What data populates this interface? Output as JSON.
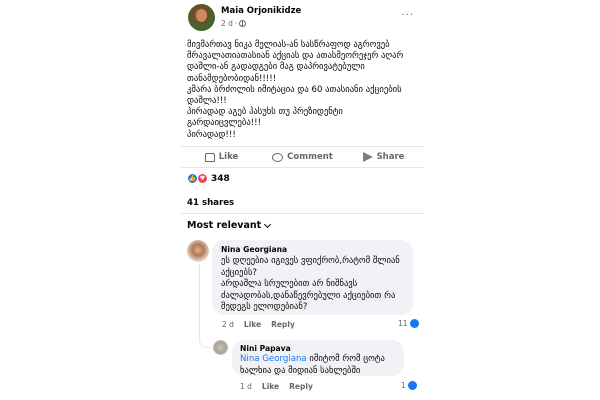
{
  "post": {
    "author": "Maia Orjonikidze",
    "time": "2 d",
    "separator": "·",
    "text": "მივმართავ ნიკა მელიას-ან სასწრაფოდ აგროვებ მრავალათიათასიან აქციას და ათასმეორეჯერ აღარ დაშლი-ან გადადგები მაგ დაპრივატებული თანამდებობიდან!!!!!\nკმარა ბრძოლის იმიტაცია და 60 ათასიანი აქციების დაშლა!!!\nპირადად აგებ პასუხს თუ პრეზიდენტი გარდაიცვლება!!!\nპირადად!!!"
  },
  "actions": {
    "like": "Like",
    "comment": "Comment",
    "share": "Share"
  },
  "stats": {
    "reactions_count": "348",
    "shares": "41 shares"
  },
  "comments_header": {
    "sort_label": "Most relevant"
  },
  "comments": [
    {
      "name": "Nina Georgiana",
      "text": "ეს დღეებია იგივეს ვფიქრობ,რატომ შლიან აქციებს?\nარდაშლა სრულებით არ ნიშნავს ძალადობას,დანაწევრებული აქციებით რა შედეგს ელოდებიან?",
      "time": "2 d",
      "like_label": "Like",
      "reply_label": "Reply",
      "reaction_count": "11"
    },
    {
      "name": "Nini Papava",
      "mention": "Nina Georgiana",
      "text": "  იმიტომ რომ ცოტა ხალხია და მიდიან სახლებში",
      "time": "1 d",
      "like_label": "Like",
      "reply_label": "Reply",
      "reaction_count": "1"
    }
  ],
  "colors": {
    "accent": "#1877f2",
    "love": "#f33e58",
    "secondary_text": "#65676b",
    "bubble": "#f0f2f5"
  },
  "icons": [
    "globe-icon",
    "more-icon",
    "like-icon",
    "comment-icon",
    "share-icon",
    "like-reaction-icon",
    "love-reaction-icon",
    "chevron-down-icon"
  ]
}
